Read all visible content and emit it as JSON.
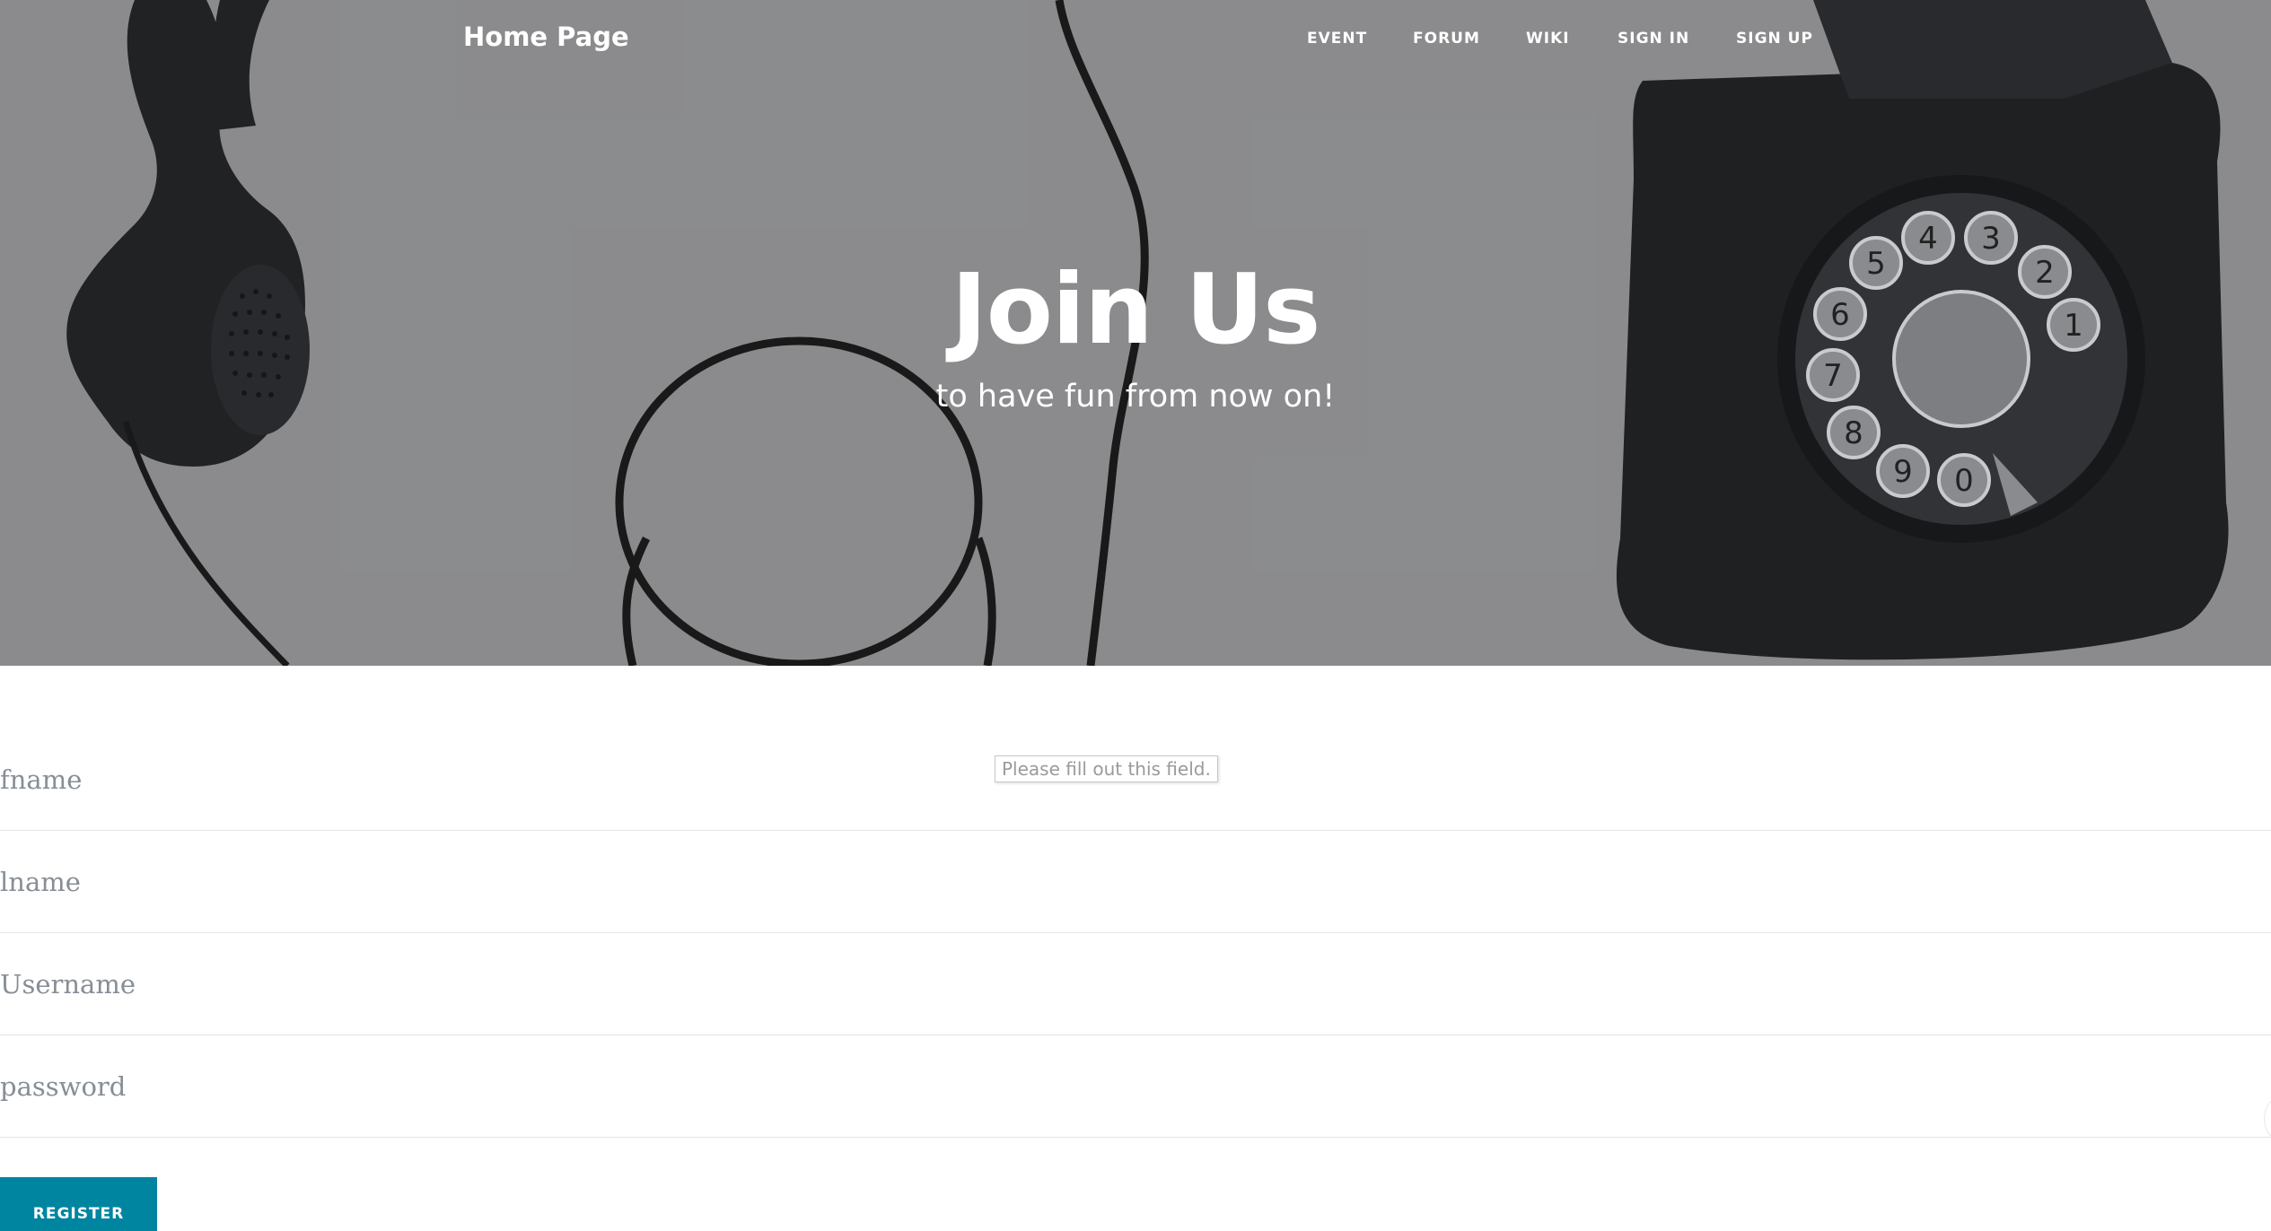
{
  "navbar": {
    "brand": "Home Page",
    "links": [
      "EVENT",
      "FORUM",
      "WIKI",
      "SIGN IN",
      "SIGN UP"
    ]
  },
  "hero": {
    "heading": "Join Us",
    "subheading": "to have fun from now on!"
  },
  "form": {
    "fields": {
      "fname": {
        "placeholder": "fname",
        "value": ""
      },
      "lname": {
        "placeholder": "lname",
        "value": ""
      },
      "username": {
        "placeholder": "Username",
        "value": ""
      },
      "password": {
        "placeholder": "password",
        "value": ""
      }
    },
    "validation_tooltip": "Please fill out this field.",
    "submit_label": "REGISTER"
  },
  "colors": {
    "hero_background": "#8b8c8e",
    "accent": "#0085a1",
    "placeholder": "#868e96"
  },
  "icons": {
    "hero_image": "vintage-rotary-telephone"
  }
}
